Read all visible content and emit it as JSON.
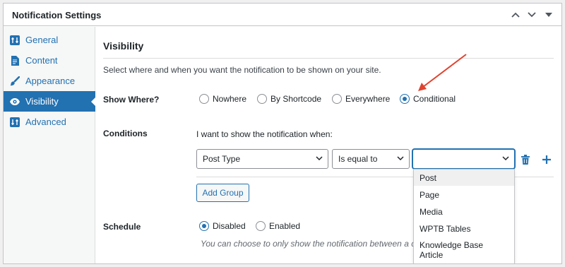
{
  "panel": {
    "title": "Notification Settings"
  },
  "sidebar": {
    "items": [
      {
        "label": "General",
        "icon": "sliders-icon"
      },
      {
        "label": "Content",
        "icon": "document-icon"
      },
      {
        "label": "Appearance",
        "icon": "paintbrush-icon"
      },
      {
        "label": "Visibility",
        "icon": "eye-icon",
        "active": true
      },
      {
        "label": "Advanced",
        "icon": "sliders-icon"
      }
    ]
  },
  "section": {
    "title": "Visibility",
    "description": "Select where and when you want the notification to be shown on your site."
  },
  "show_where": {
    "label": "Show Where?",
    "options": [
      "Nowhere",
      "By Shortcode",
      "Everywhere",
      "Conditional"
    ],
    "selected": "Conditional"
  },
  "conditions": {
    "label": "Conditions",
    "intro": "I want to show the notification when:",
    "field_value": "Post Type",
    "operator_value": "Is equal to",
    "value_value": "",
    "add_group_label": "Add Group",
    "dropdown_options": [
      "Post",
      "Page",
      "Media",
      "WPTB Tables",
      "Knowledge Base Article"
    ],
    "dropdown_open": true
  },
  "schedule": {
    "label": "Schedule",
    "options": [
      "Disabled",
      "Enabled"
    ],
    "selected": "Disabled",
    "hint": "You can choose to only show the notification between a ce"
  },
  "colors": {
    "accent": "#2271b1",
    "annotation_arrow": "#e0432f"
  }
}
